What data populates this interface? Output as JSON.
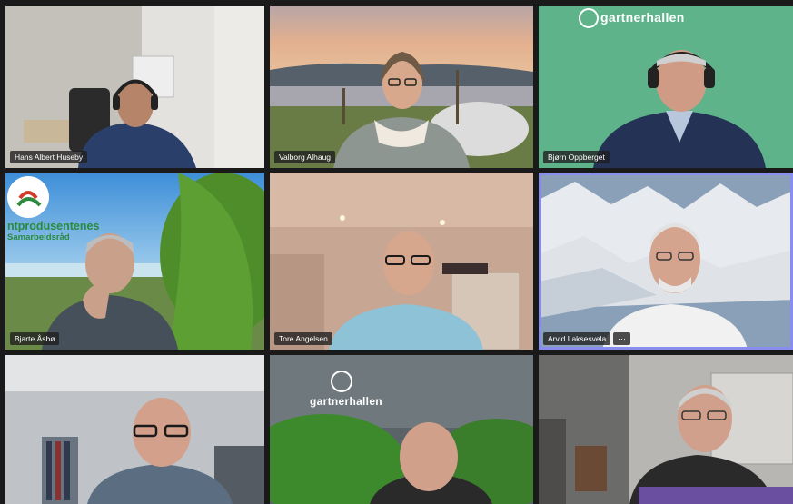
{
  "participants": [
    {
      "name": "Hans Albert Huseby"
    },
    {
      "name": "Valborg Alhaug"
    },
    {
      "name": "Bjørn Oppberget"
    },
    {
      "name": "Bjarte Åsbø"
    },
    {
      "name": "Tore Angelsen"
    },
    {
      "name": "Arvid Laksesvela"
    },
    {
      "name": ""
    },
    {
      "name": ""
    },
    {
      "name": ""
    }
  ],
  "branding": {
    "company_name": "gartnerhallen",
    "coop_line1": "ntprodusentenes",
    "coop_line2": "Samarbeidsråd"
  },
  "controls": {
    "more_options_label": "···"
  },
  "colors": {
    "active_speaker_border": "#8a8df0",
    "gartnerhallen_green": "#5fb38b",
    "name_tag_bg": "#1e1e1e"
  }
}
